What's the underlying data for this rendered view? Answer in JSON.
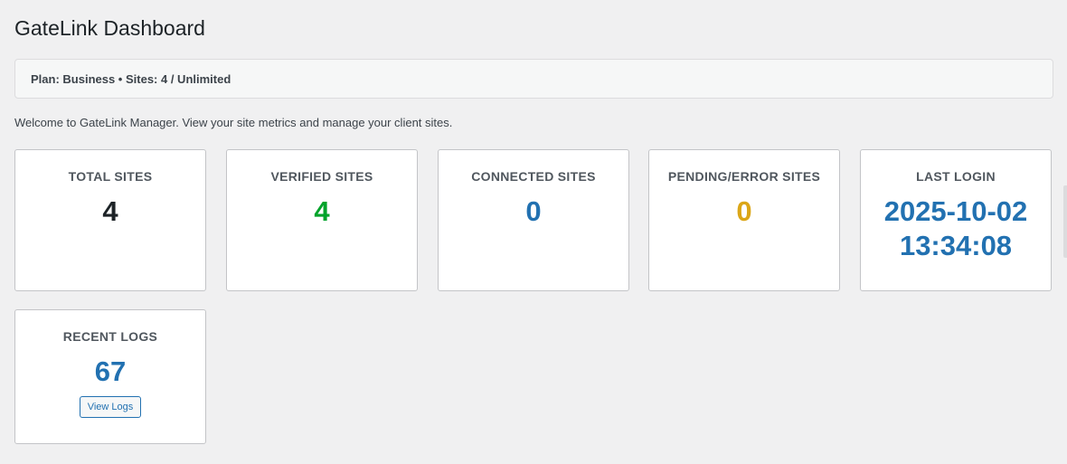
{
  "page": {
    "title": "GateLink Dashboard",
    "plan_info": "Plan: Business • Sites: 4 / Unlimited",
    "welcome": "Welcome to GateLink Manager. View your site metrics and manage your client sites."
  },
  "cards": {
    "total_sites": {
      "title": "TOTAL SITES",
      "value": "4"
    },
    "verified_sites": {
      "title": "VERIFIED SITES",
      "value": "4"
    },
    "connected_sites": {
      "title": "CONNECTED SITES",
      "value": "0"
    },
    "pending_error_sites": {
      "title": "PENDING/ERROR SITES",
      "value": "0"
    },
    "last_login": {
      "title": "LAST LOGIN",
      "date": "2025-10-02",
      "time": "13:34:08"
    },
    "recent_logs": {
      "title": "RECENT LOGS",
      "value": "67",
      "button_label": "View Logs"
    }
  },
  "colors": {
    "background": "#f0f0f1",
    "verified": "#00a32a",
    "connected": "#2271b1",
    "pending": "#dba617",
    "accent": "#2271b1"
  }
}
